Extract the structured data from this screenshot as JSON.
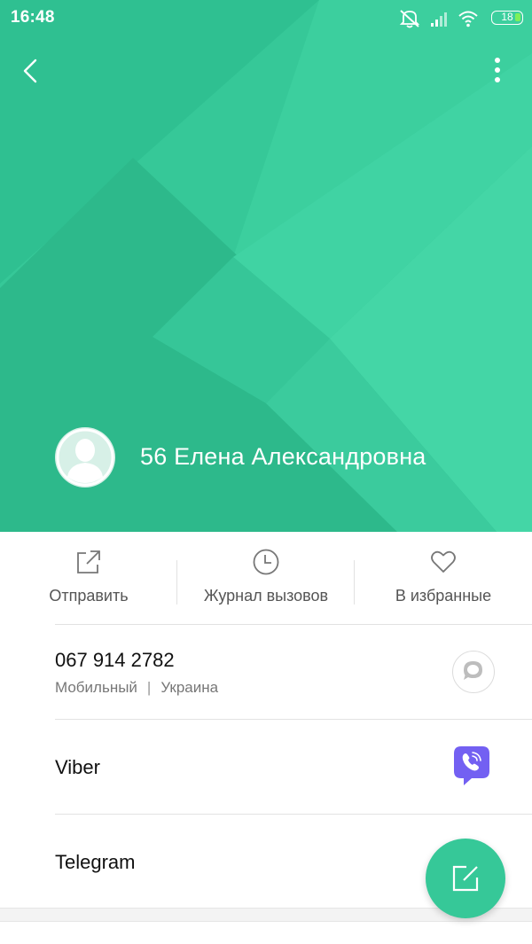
{
  "status_bar": {
    "time": "16:48",
    "battery_level": "18",
    "icons": [
      "silent-icon",
      "signal-icon",
      "wifi-icon",
      "battery-icon"
    ]
  },
  "header": {
    "back_icon": "chevron-left-icon",
    "menu_icon": "more-vertical-icon",
    "avatar_icon": "person-avatar-icon",
    "contact_name": "56 Елена Александровна",
    "color": "#36c898"
  },
  "actions": [
    {
      "label": "Отправить",
      "icon": "share-icon"
    },
    {
      "label": "Журнал вызовов",
      "icon": "clock-icon"
    },
    {
      "label": "В избранные",
      "icon": "heart-icon"
    }
  ],
  "phone": {
    "number": "067 914 2782",
    "type": "Мобильный",
    "separator": "|",
    "region": "Украина",
    "action_icon": "message-icon"
  },
  "apps": [
    {
      "label": "Viber",
      "icon": "viber-icon",
      "color": "#7360f2"
    },
    {
      "label": "Telegram",
      "icon": "telegram-icon"
    }
  ],
  "fab": {
    "icon": "edit-icon"
  }
}
